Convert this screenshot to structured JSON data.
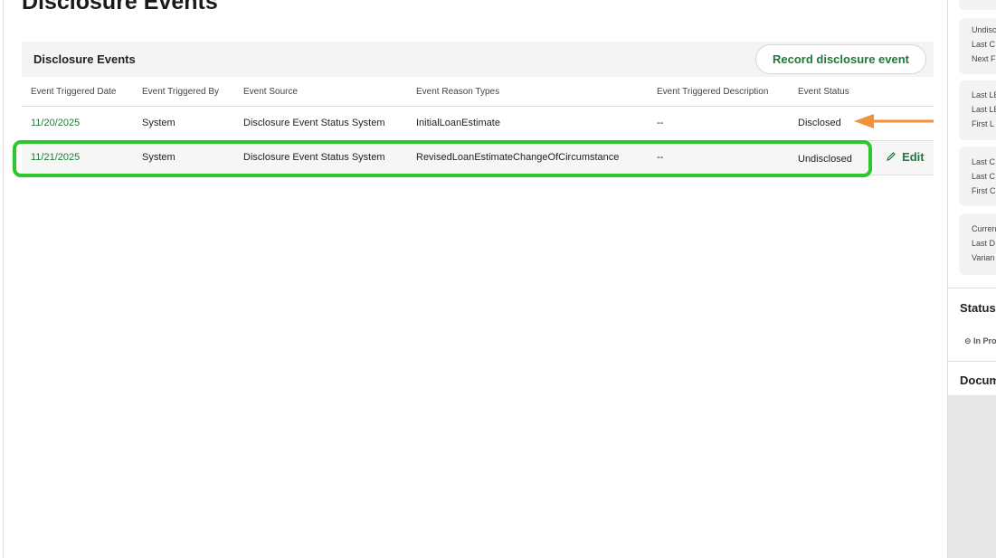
{
  "page": {
    "title": "Disclosure Events"
  },
  "panel": {
    "title": "Disclosure Events",
    "record_button": "Record disclosure event"
  },
  "table": {
    "columns": [
      "Event Triggered Date",
      "Event Triggered By",
      "Event Source",
      "Event Reason Types",
      "Event Triggered Description",
      "Event Status"
    ],
    "rows": [
      {
        "date": "11/20/2025",
        "by": "System",
        "source": "Disclosure Event Status System",
        "reason": "InitialLoanEstimate",
        "description": "--",
        "status": "Disclosed",
        "action": ""
      },
      {
        "date": "11/21/2025",
        "by": "System",
        "source": "Disclosure Event Status System",
        "reason": "RevisedLoanEstimateChangeOfCircumstance",
        "description": "--",
        "status": "Undisclosed",
        "action": "Edit"
      }
    ]
  },
  "right_panel": {
    "cards": [
      [
        "Undisc",
        "Last C",
        "Next F"
      ],
      [
        "Last LE",
        "Last LE",
        "First L"
      ],
      [
        "Last C",
        "Last C",
        "First C"
      ],
      [
        "Curren",
        "Last D",
        "Varian"
      ]
    ],
    "status_label": "Status",
    "status_value": "In Pro",
    "documents_label": "Docum"
  },
  "colors": {
    "accent": "#1f7a3a",
    "highlight": "#2ec52e",
    "arrow": "#f0923a"
  }
}
